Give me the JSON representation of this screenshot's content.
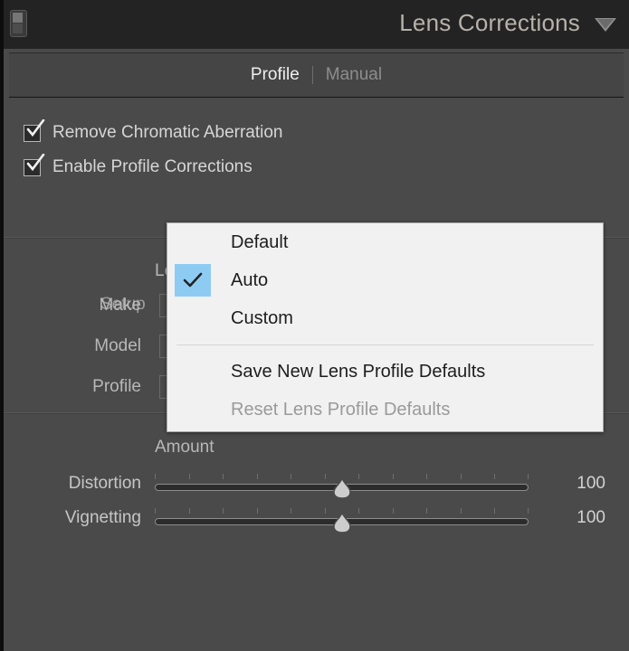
{
  "header": {
    "title": "Lens Corrections",
    "toggle_icon": "panel-switch-icon",
    "collapse_icon": "chevron-down-icon"
  },
  "tabs": [
    {
      "label": "Profile",
      "active": true
    },
    {
      "label": "Manual",
      "active": false
    }
  ],
  "checkboxes": [
    {
      "label": "Remove Chromatic Aberration",
      "checked": true
    },
    {
      "label": "Enable Profile Corrections",
      "checked": true
    }
  ],
  "setup": {
    "label": "Setup",
    "value": "Auto",
    "stepper_icon": "up-down-arrows-icon"
  },
  "lens_profile": {
    "section_label": "Lens Profile",
    "fields": [
      {
        "label": "Make",
        "value": ""
      },
      {
        "label": "Model",
        "value": ""
      },
      {
        "label": "Profile",
        "value": ""
      }
    ]
  },
  "amount": {
    "label": "Amount",
    "sliders": [
      {
        "label": "Distortion",
        "value": "100",
        "position_pct": 50
      },
      {
        "label": "Vignetting",
        "value": "100",
        "position_pct": 50
      }
    ]
  },
  "menu": {
    "items": [
      {
        "label": "Default",
        "checked": false,
        "disabled": false
      },
      {
        "label": "Auto",
        "checked": true,
        "disabled": false
      },
      {
        "label": "Custom",
        "checked": false,
        "disabled": false
      },
      {
        "label": "Save New Lens Profile Defaults",
        "checked": false,
        "disabled": false
      },
      {
        "label": "Reset Lens Profile Defaults",
        "checked": false,
        "disabled": true
      }
    ],
    "separator_after_index": 2,
    "check_highlight_color": "#8ecbf2"
  },
  "colors": {
    "panel_bg": "#4a4a4a",
    "header_bg": "#232323",
    "tabbar_bg": "#454545",
    "menu_bg": "#f1f1f1",
    "title_text": "#b7b2aa"
  }
}
